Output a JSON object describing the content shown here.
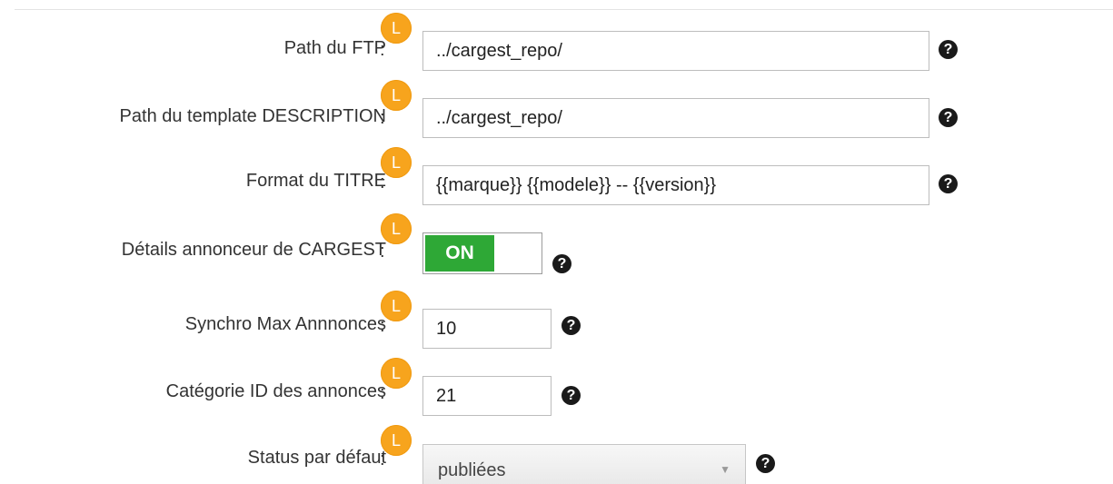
{
  "form": {
    "badge_letter": "L",
    "help_glyph": "?",
    "colon": ":",
    "rows": [
      {
        "label": "Path du FTP",
        "value": "../cargest_repo/"
      },
      {
        "label": "Path du template DESCRIPTION",
        "value": "../cargest_repo/"
      },
      {
        "label": "Format du TITRE",
        "value": "{{marque}} {{modele}} -- {{version}}"
      },
      {
        "label": "Détails annonceur de CARGEST",
        "toggle_label": "ON",
        "toggle_state": true
      },
      {
        "label": "Synchro Max Annnonces",
        "value": "10"
      },
      {
        "label": "Catégorie ID des annonces",
        "value": "21"
      },
      {
        "label": "Status par défaut",
        "selected": "publiées"
      }
    ]
  },
  "icons": {
    "badge": "language-badge-icon",
    "help": "help-circle-icon",
    "dropdown": "chevron-down-icon"
  },
  "colors": {
    "badge": "#f7a41d",
    "toggle_on": "#2ea836",
    "help_icon": "#1a1a1a"
  }
}
